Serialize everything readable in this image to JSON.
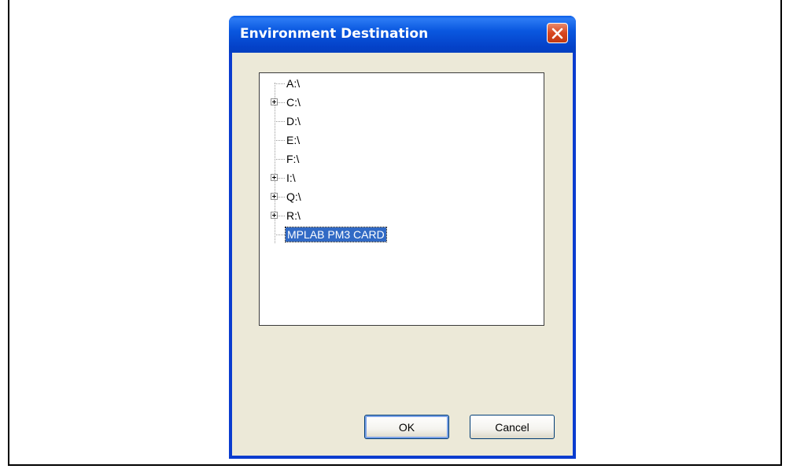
{
  "dialog": {
    "title": "Environment Destination",
    "close_icon": "close-icon"
  },
  "tree": {
    "items": [
      {
        "label": "A:\\",
        "expandable": false
      },
      {
        "label": "C:\\",
        "expandable": true
      },
      {
        "label": "D:\\",
        "expandable": false
      },
      {
        "label": "E:\\",
        "expandable": false
      },
      {
        "label": "F:\\",
        "expandable": false
      },
      {
        "label": "I:\\",
        "expandable": true
      },
      {
        "label": "Q:\\",
        "expandable": true
      },
      {
        "label": "R:\\",
        "expandable": true
      },
      {
        "label": "MPLAB PM3 CARD",
        "expandable": false,
        "selected": true
      }
    ]
  },
  "buttons": {
    "ok_label": "OK",
    "cancel_label": "Cancel"
  },
  "colors": {
    "titlebar": "#0a58e0",
    "selection": "#316ac5",
    "client_bg": "#ece9d8"
  }
}
